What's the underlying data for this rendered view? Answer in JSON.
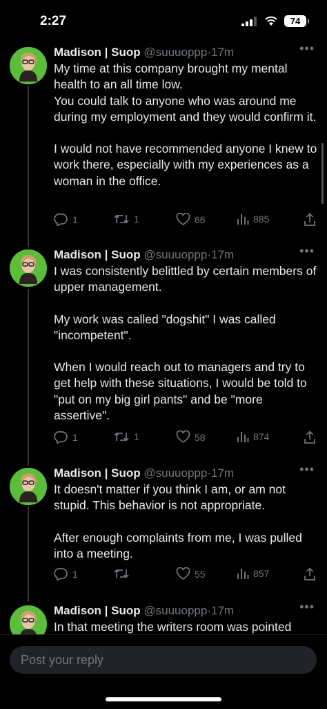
{
  "status_bar": {
    "time": "2:27",
    "battery": "74"
  },
  "tweets": [
    {
      "name": "Madison | Suop",
      "handle": "@suuuoppp",
      "dot": "·",
      "time": "17m",
      "paragraphs": [
        "My time at this company brought my mental health to an all time low.\nYou could talk to anyone who was around me during my employment and they would confirm it.",
        "I would not have recommended anyone I knew to work there, especially with my experiences as a woman in the office."
      ],
      "replies": "1",
      "retweets": "1",
      "likes": "66",
      "views": "885"
    },
    {
      "name": "Madison | Suop",
      "handle": "@suuuoppp",
      "dot": "·",
      "time": "17m",
      "paragraphs": [
        "I was consistently belittled by certain members of upper management.",
        "My work was called \"dogshit\" I was called \"incompetent\".",
        "When I would reach out to managers and try to get help with these situations, I would be told to \"put on my big girl pants\" and be \"more assertive\"."
      ],
      "replies": "1",
      "retweets": "1",
      "likes": "58",
      "views": "874"
    },
    {
      "name": "Madison | Suop",
      "handle": "@suuuoppp",
      "dot": "·",
      "time": "17m",
      "paragraphs": [
        "It doesn't matter if you think I am, or am not stupid. This behavior is not appropriate.",
        "After enough complaints from me, I was pulled into a meeting."
      ],
      "replies": "1",
      "retweets": "",
      "likes": "55",
      "views": "857"
    },
    {
      "name": "Madison | Suop",
      "handle": "@suuuoppp",
      "dot": "·",
      "time": "17m",
      "paragraphs": [
        "In that meeting the writers room was pointed"
      ]
    }
  ],
  "reply_bar": {
    "placeholder": "Post your reply"
  },
  "colors": {
    "background": "#000000",
    "text": "#e7e9ea",
    "secondary": "#71767b",
    "avatar_bg": "#5bbd3a"
  }
}
